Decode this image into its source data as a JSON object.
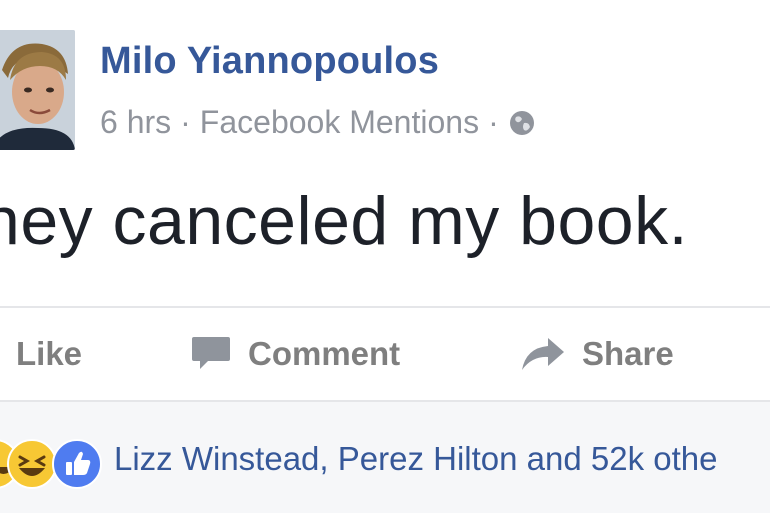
{
  "post": {
    "author_name": "Milo Yiannopoulos",
    "timestamp": "6 hrs",
    "separator": "·",
    "source": "Facebook Mentions",
    "privacy_icon": "globe-icon",
    "message": "hey canceled my book."
  },
  "actions": {
    "like_label": "Like",
    "comment_label": "Comment",
    "share_label": "Share"
  },
  "reactions": {
    "icons": [
      "haha-reaction-icon",
      "like-reaction-icon"
    ],
    "summary": "Lizz Winstead, Perez Hilton and 52k othe"
  },
  "colors": {
    "author_link": "#365899",
    "meta_text": "#90949c",
    "action_text": "#7f7f7f",
    "footer_bg": "#f6f7f9",
    "like_blue": "#4f7cf0",
    "haha_yellow": "#f7c834"
  }
}
